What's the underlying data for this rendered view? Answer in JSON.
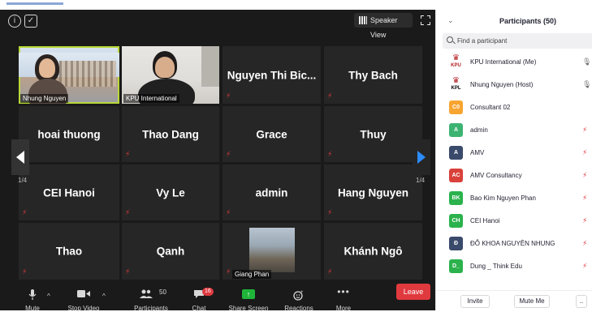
{
  "meeting": {
    "view_button": "Speaker View",
    "pager_left": "1/4",
    "pager_right": "1/4",
    "tiles": [
      {
        "name": "Nhung Nguyen",
        "kind": "video"
      },
      {
        "name": "KPU International",
        "kind": "video"
      },
      {
        "name": "Nguyen Thi Bic...",
        "kind": "text"
      },
      {
        "name": "Thy Bach",
        "kind": "text"
      },
      {
        "name": "hoai thuong",
        "kind": "text"
      },
      {
        "name": "Thao Dang",
        "kind": "text"
      },
      {
        "name": "Grace",
        "kind": "text"
      },
      {
        "name": "Thuy",
        "kind": "text"
      },
      {
        "name": "CEI Hanoi",
        "kind": "text"
      },
      {
        "name": "Vy Le",
        "kind": "text"
      },
      {
        "name": "admin",
        "kind": "text"
      },
      {
        "name": "Hang Nguyen",
        "kind": "text"
      },
      {
        "name": "Thao",
        "kind": "text"
      },
      {
        "name": "Qanh",
        "kind": "text"
      },
      {
        "name": "Giang Phan",
        "kind": "image"
      },
      {
        "name": "Khánh Ngô",
        "kind": "text"
      }
    ]
  },
  "toolbar": {
    "mute": "Mute",
    "stop_video": "Stop Video",
    "participants": "Participants",
    "participants_count": "50",
    "chat": "Chat",
    "chat_badge": "16",
    "share_screen": "Share Screen",
    "reactions": "Reactions",
    "more": "More",
    "leave": "Leave",
    "share_color": "#1fb53a",
    "leave_color": "#e0393e"
  },
  "panel": {
    "title": "Participants (50)",
    "search_placeholder": "Find a participant",
    "invite": "Invite",
    "mute_me": "Mute Me",
    "more": "..",
    "participants": [
      {
        "name": "KPU International (Me)",
        "initials": "",
        "color": "#ffffff",
        "logo": "KPU",
        "mic": "on"
      },
      {
        "name": "Nhung Nguyen (Host)",
        "initials": "",
        "color": "#ffffff",
        "logo": "KPL",
        "mic": "on"
      },
      {
        "name": "Consultant 02",
        "initials": "C0",
        "color": "#f7a531",
        "mic": "none"
      },
      {
        "name": "admin",
        "initials": "A",
        "color": "#3cb371",
        "mic": "muted"
      },
      {
        "name": "AMV",
        "initials": "A",
        "color": "#3a4a6b",
        "mic": "muted"
      },
      {
        "name": "AMV Consultancy",
        "initials": "AC",
        "color": "#d9413a",
        "mic": "muted"
      },
      {
        "name": "Bao Kim Nguyen Phan",
        "initials": "BK",
        "color": "#2bb24c",
        "mic": "muted"
      },
      {
        "name": "CEI Hanoi",
        "initials": "CH",
        "color": "#2bb24c",
        "mic": "muted"
      },
      {
        "name": "ĐỖ KHOA NGUYÊN NHUNG",
        "initials": "Đ",
        "color": "#3a4a6b",
        "mic": "muted"
      },
      {
        "name": "Dung _ Think Edu",
        "initials": "D_",
        "color": "#2bb24c",
        "mic": "muted"
      }
    ]
  }
}
